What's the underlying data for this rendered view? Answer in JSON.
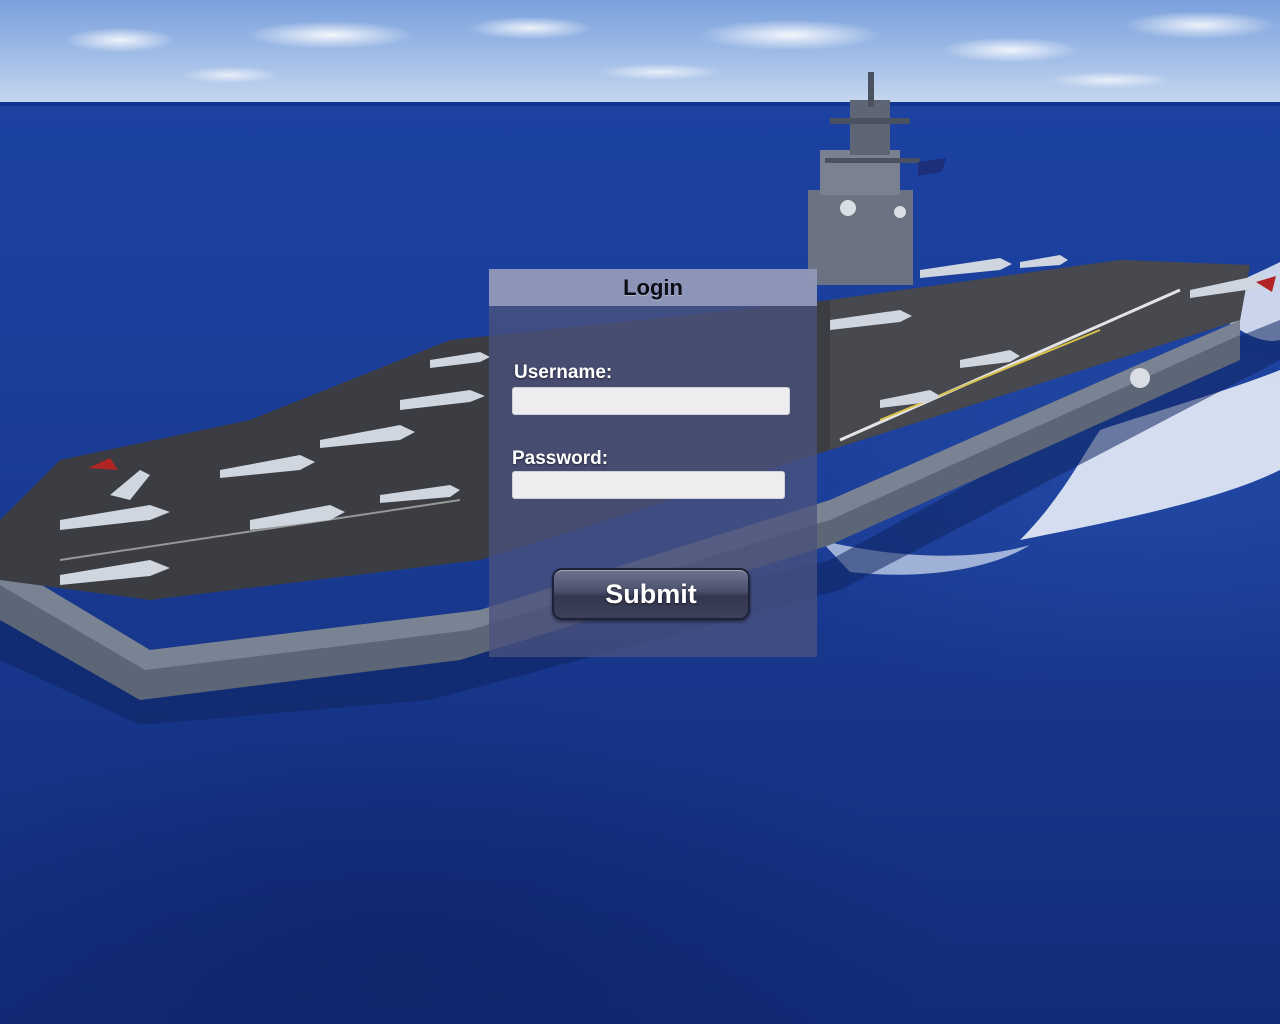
{
  "login": {
    "title": "Login",
    "username_label": "Username:",
    "username_value": "",
    "password_label": "Password:",
    "password_value": "",
    "submit_label": "Submit"
  },
  "background": {
    "subject": "aircraft carrier at sea",
    "sea_color": "#1a3d98",
    "sky_color": "#a5c0e8"
  },
  "colors": {
    "panel": "#4a527e",
    "panel_header": "#969ebe",
    "button": "#3c4159"
  }
}
